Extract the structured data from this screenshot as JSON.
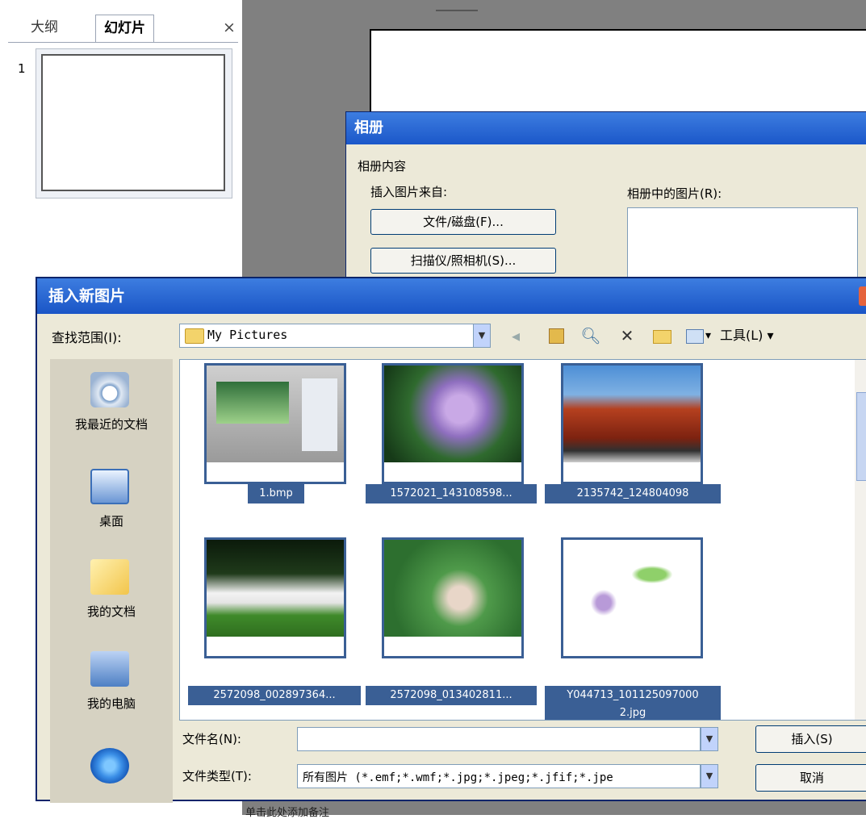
{
  "left_pane": {
    "tabs": [
      {
        "label": "大纲"
      },
      {
        "label": "幻灯片"
      }
    ],
    "close_glyph": "×",
    "slide_number": "1"
  },
  "album_dialog": {
    "title": "相册",
    "content_label": "相册内容",
    "insert_from_label": "插入图片来自:",
    "file_button": "文件/磁盘(F)...",
    "scanner_button": "扫描仪/照相机(S)...",
    "pictures_label": "相册中的图片(R):"
  },
  "insert_dialog": {
    "title": "插入新图片",
    "look_in_label": "查找范围(I):",
    "look_in_value": "My Pictures",
    "tools_label": "工具(L)",
    "places": [
      {
        "label": "我最近的文档",
        "icon": "recent-documents-icon"
      },
      {
        "label": "桌面",
        "icon": "desktop-icon"
      },
      {
        "label": "我的文档",
        "icon": "my-documents-icon"
      },
      {
        "label": "我的电脑",
        "icon": "my-computer-icon"
      },
      {
        "label": "",
        "icon": "network-places-icon"
      }
    ],
    "files": [
      {
        "name": "1.bmp",
        "icon": "screenshot-thumbnail"
      },
      {
        "name": "1572021_143108598...",
        "icon": "purple-flower-thumbnail"
      },
      {
        "name": "2135742_124804098",
        "icon": "red-tree-thumbnail"
      },
      {
        "name": "2572098_002897364...",
        "icon": "dancer-thumbnail"
      },
      {
        "name": "2572098_013402811...",
        "icon": "lotus-girl-thumbnail"
      },
      {
        "name": "Y044713_101125097000",
        "name_line2": "2.jpg",
        "icon": "vine-drawing-thumbnail"
      }
    ],
    "filename_label": "文件名(N):",
    "filename_value": "",
    "filetype_label": "文件类型(T):",
    "filetype_value": "所有图片 (*.emf;*.wmf;*.jpg;*.jpeg;*.jfif;*.jpe",
    "insert_button": "插入(S)",
    "cancel_button": "取消",
    "accent_color": "#1b57c9"
  },
  "footer_text": "单击此处添加备注"
}
